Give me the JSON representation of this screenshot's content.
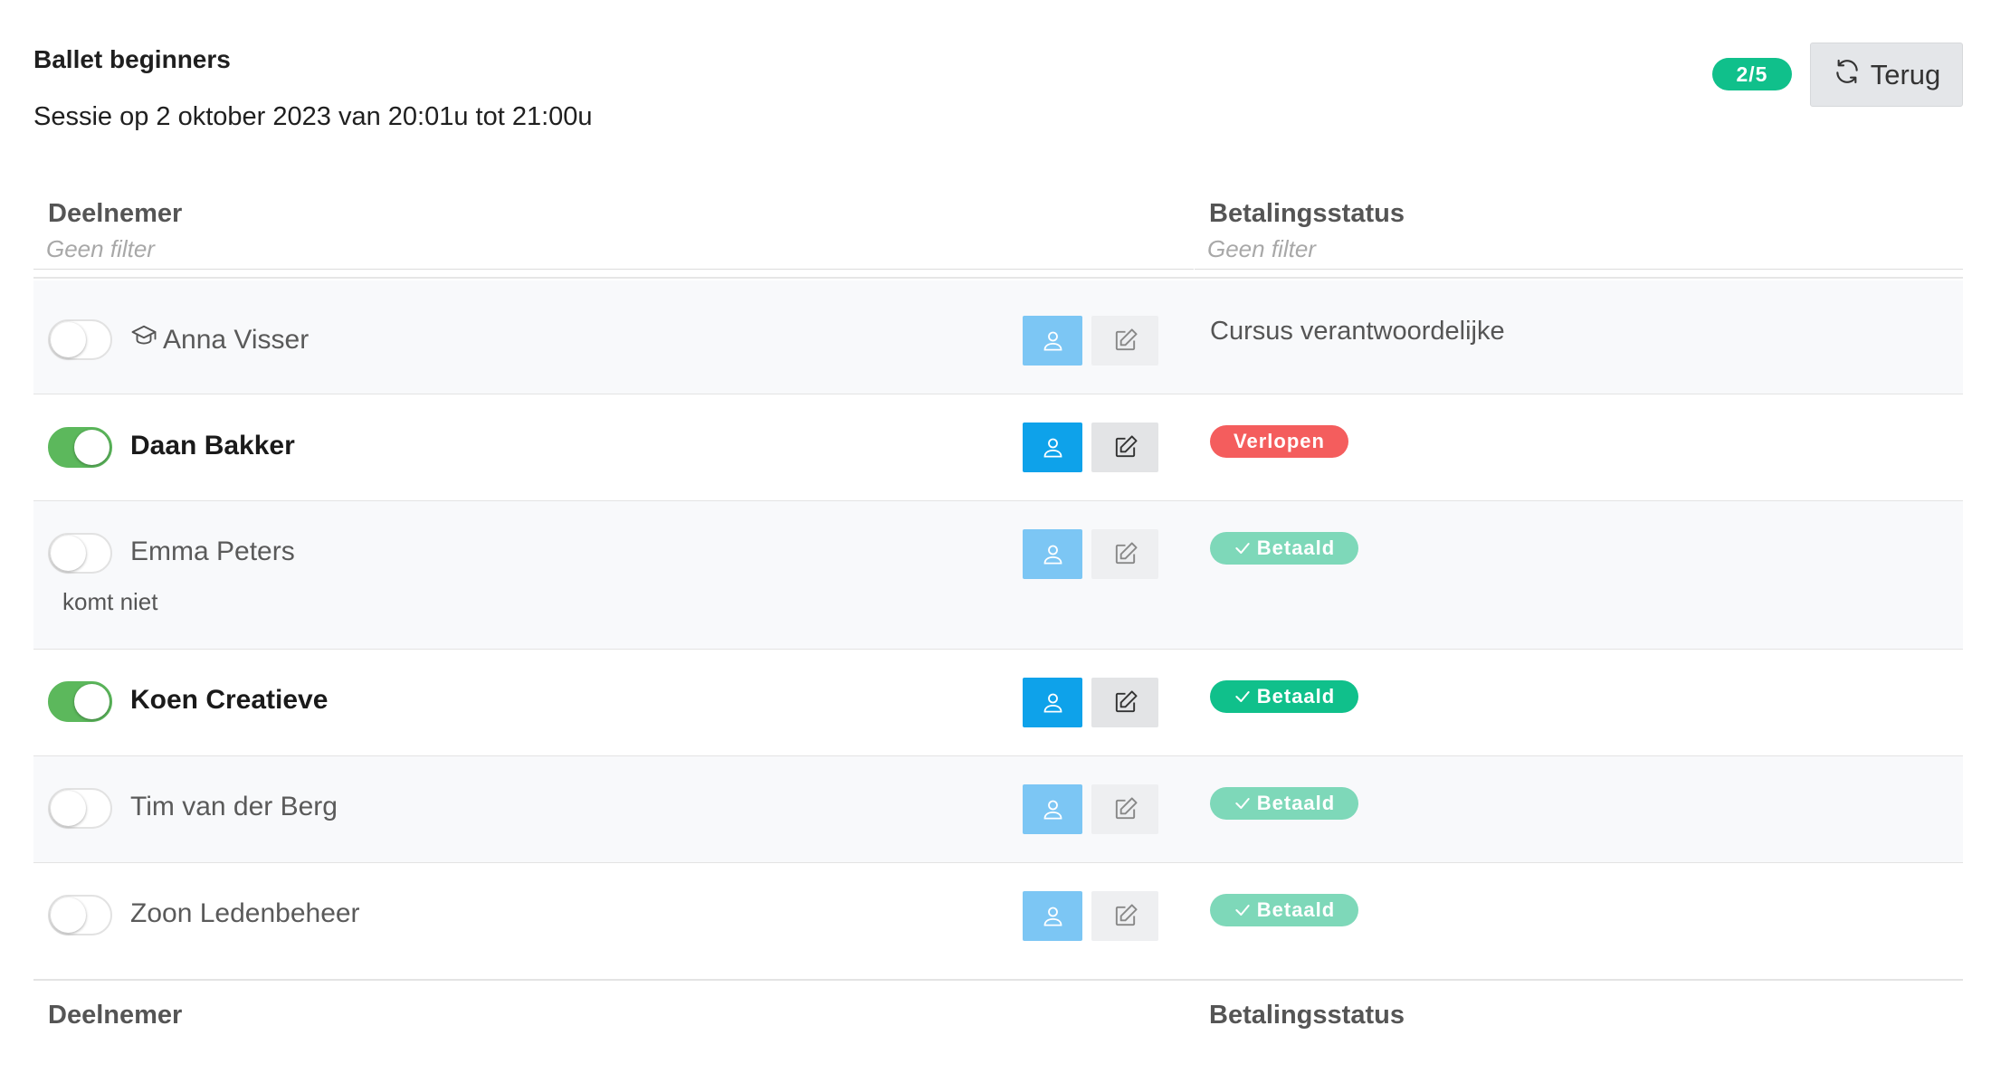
{
  "header": {
    "title": "Ballet beginners",
    "subtitle": "Sessie op 2 oktober 2023 van 20:01u tot 21:00u",
    "count_badge": "2/5",
    "back_label": "Terug"
  },
  "table": {
    "columns": [
      {
        "label": "Deelnemer",
        "filter_placeholder": "Geen filter"
      },
      {
        "label": "Betalingsstatus",
        "filter_placeholder": "Geen filter"
      }
    ],
    "rows": [
      {
        "name": "Anna Visser",
        "present": false,
        "role_icon": "graduation-cap-icon",
        "status_type": "text",
        "status": "Cursus verantwoordelijke",
        "note": ""
      },
      {
        "name": "Daan Bakker",
        "present": true,
        "status_type": "badge",
        "status": "Verlopen",
        "status_color": "#f45d5d",
        "note": ""
      },
      {
        "name": "Emma Peters",
        "present": false,
        "status_type": "badge",
        "status": "Betaald",
        "status_color": "#7ed8b9",
        "note": "komt niet"
      },
      {
        "name": "Koen Creatieve",
        "present": true,
        "status_type": "badge",
        "status": "Betaald",
        "status_color": "#10c08b",
        "note": ""
      },
      {
        "name": "Tim van der Berg",
        "present": false,
        "status_type": "badge",
        "status": "Betaald",
        "status_color": "#7ed8b9",
        "note": ""
      },
      {
        "name": "Zoon Ledenbeheer",
        "present": false,
        "status_type": "badge",
        "status": "Betaald",
        "status_color": "#7ed8b9",
        "note": ""
      }
    ],
    "footer_columns": [
      "Deelnemer",
      "Betalingsstatus"
    ]
  },
  "colors": {
    "accent_green": "#10c08b",
    "toggle_on": "#5cb85c",
    "user_button": "#0ea2ea",
    "expired_red": "#f45d5d"
  }
}
